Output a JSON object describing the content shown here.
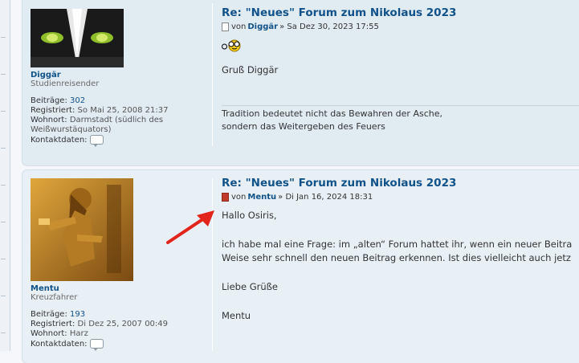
{
  "posts": [
    {
      "title": "Re: \"Neues\" Forum zum Nikolaus 2023",
      "by": "von",
      "author": "Diggär",
      "date": "» Sa Dez 30, 2023 17:55",
      "username": "Diggär",
      "rank": "Studienreisender",
      "labels": {
        "posts": "Beiträge:",
        "registered": "Registriert:",
        "location": "Wohnort:",
        "contact": "Kontaktdaten:"
      },
      "post_count": "302",
      "registered": "So Mai 25, 2008 21:37",
      "location_line1": "Darmstadt (südlich des",
      "location_line2": "Weißwurstäquators)",
      "greeting": "Gruß Diggär",
      "signature_line1": "Tradition bedeutet nicht das Bewahren der Asche,",
      "signature_line2": "sondern das Weitergeben des Feuers"
    },
    {
      "title": "Re: \"Neues\" Forum zum Nikolaus 2023",
      "by": "von",
      "author": "Mentu",
      "date": "» Di Jan 16, 2024 18:31",
      "username": "Mentu",
      "rank": "Kreuzfahrer",
      "labels": {
        "posts": "Beiträge:",
        "registered": "Registriert:",
        "location": "Wohnort:",
        "contact": "Kontaktdaten:"
      },
      "post_count": "193",
      "registered": "Di Dez 25, 2007 00:49",
      "location": "Harz",
      "line1": "Hallo Osiris,",
      "line2": "ich habe mal eine Frage: im „alten“ Forum hattet ihr, wenn ein neuer Beitra",
      "line3": "Weise sehr schnell den neuen Beitrag erkennen. Ist dies vielleicht auch jetz",
      "line4": "Liebe Grüße",
      "line5": "Mentu"
    }
  ],
  "colors": {
    "link": "#105289",
    "post_bg": "#e1ebf2",
    "arrow": "#e3241b"
  },
  "icons": {
    "post_read": "post-icon",
    "post_unread": "post-unread-icon",
    "smiley": "glasses-smiley-icon",
    "arrow": "red-arrow-annotation"
  }
}
